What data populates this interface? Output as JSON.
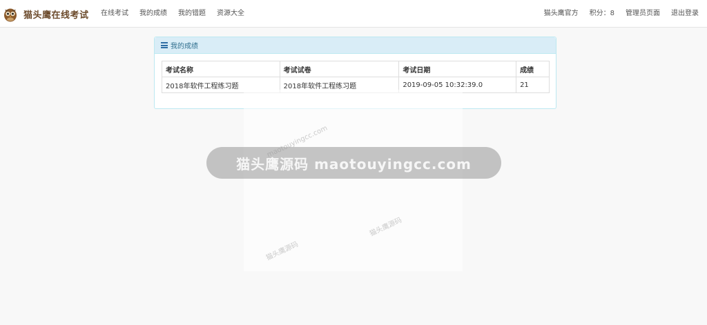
{
  "brand": {
    "name": "猫头鹰在线考试",
    "logo_icon": "owl-icon"
  },
  "nav_left": [
    {
      "label": "在线考试"
    },
    {
      "label": "我的成绩"
    },
    {
      "label": "我的错题"
    },
    {
      "label": "资源大全"
    }
  ],
  "nav_right": {
    "official": "猫头鹰官方",
    "points": "积分：8",
    "admin": "管理员页面",
    "logout": "退出登录"
  },
  "panel": {
    "title": "我的成绩",
    "icon": "list-icon",
    "table": {
      "headers": [
        "考试名称",
        "考试试卷",
        "考试日期",
        "成绩"
      ],
      "rows": [
        [
          "2018年软件工程练习题",
          "2018年软件工程练习题",
          "2019-09-05 10:32:39.0",
          "21"
        ]
      ]
    }
  },
  "watermark": {
    "pill": "猫头鹰源码 maotouyingcc.com",
    "site": "maotouyingcc.com",
    "name": "猫头鹰源码"
  },
  "colors": {
    "panel_heading_bg": "#d9edf7",
    "panel_border": "#bce8f1",
    "panel_title": "#31708f",
    "page_bg": "#f8f8f8",
    "brand": "#6b4a2b"
  }
}
